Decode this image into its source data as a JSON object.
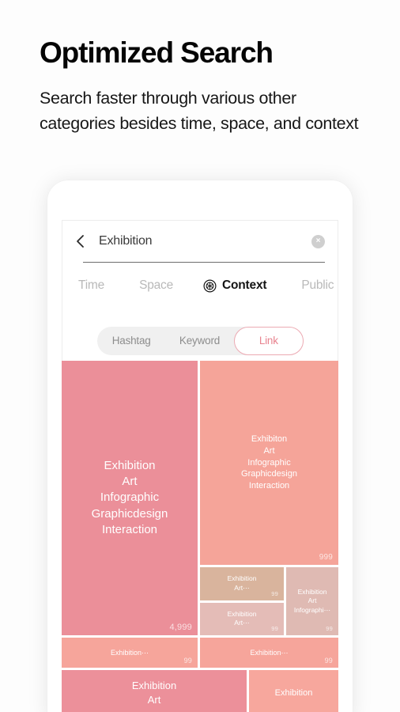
{
  "hero": {
    "title": "Optimized Search",
    "subtitle": "Search faster through various other categories besides time, space, and context"
  },
  "phone": {
    "search": {
      "value": "Exhibition",
      "back_icon": "chevron-left-icon",
      "clear_icon": "clear-circle-icon",
      "clear_glyph": "×"
    },
    "tabs": [
      {
        "label": "Time",
        "active": false
      },
      {
        "label": "Space",
        "active": false
      },
      {
        "label": "Context",
        "active": true,
        "icon": "context-badge-icon"
      },
      {
        "label": "Public",
        "active": false
      }
    ],
    "segmented": {
      "options": [
        "Hashtag",
        "Keyword",
        "Link"
      ],
      "selected": "Link",
      "selected_color": "#e8838f"
    }
  },
  "chart_data": {
    "type": "treemap",
    "title": "Exhibition link categories",
    "value_label": "count",
    "nodes": [
      {
        "id": "a",
        "label": "Exhibition\nArt\nInfographic\nGraphicdesign\nInteraction",
        "value": 4999,
        "value_text": "4,999",
        "color": "#eb8f99"
      },
      {
        "id": "b",
        "label": "Exhibiton\nArt\nInfographic\nGraphicdesign\nInteraction",
        "value": 999,
        "value_text": "999",
        "color": "#f5a499"
      },
      {
        "id": "c",
        "label": "Exhibition\nArt⋯",
        "value": 99,
        "value_text": "99",
        "color": "#d9b49d"
      },
      {
        "id": "d",
        "label": "Exhibition\nArt⋯",
        "value": 99,
        "value_text": "99",
        "color": "#e4bcb7"
      },
      {
        "id": "e",
        "label": "Exhibition\nArt\nInfographi⋯",
        "value": 99,
        "value_text": "99",
        "color": "#dfbab3"
      },
      {
        "id": "f",
        "label": "Exhibition⋯",
        "value": 99,
        "value_text": "99",
        "color": "#f6a59b"
      },
      {
        "id": "g",
        "label": "Exhibition⋯",
        "value": 99,
        "value_text": "99",
        "color": "#f6a59b"
      },
      {
        "id": "h",
        "label": "Exhibition\nArt",
        "value": null,
        "value_text": "",
        "color": "#ec909a"
      },
      {
        "id": "i",
        "label": "Exhibition",
        "value": null,
        "value_text": "",
        "color": "#f7a79d"
      }
    ]
  }
}
